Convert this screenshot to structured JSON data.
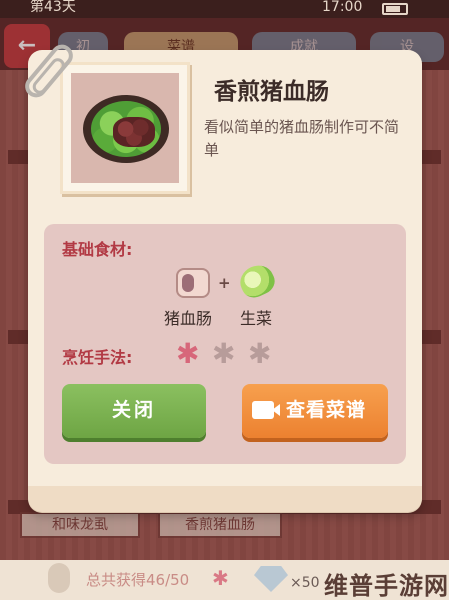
{
  "status_bar": {
    "day": "第43天",
    "time": "17:00"
  },
  "background": {
    "tabs": [
      {
        "label": "初"
      },
      {
        "label": "菜谱",
        "active": true
      },
      {
        "label": "成就"
      },
      {
        "label": "设"
      }
    ],
    "shelf_labels": [
      "和味龙虱",
      "香煎猪血肠"
    ],
    "total_label": "总共获得46/50",
    "gem_count": "×50",
    "watermark": "维普手游网"
  },
  "dialog": {
    "dish_name": "香煎猪血肠",
    "description": "看似简单的猪血肠制作可不简单",
    "ingredients_label": "基础食材:",
    "ingredients": [
      {
        "name": "猪血肠",
        "icon": "blood-sausage-icon"
      },
      {
        "name": "生菜",
        "icon": "lettuce-icon"
      }
    ],
    "plus": "+",
    "cooking_label": "烹饪手法:",
    "difficulty": {
      "filled": 1,
      "total": 3
    },
    "buttons": {
      "close": "关闭",
      "view_recipe": "查看菜谱"
    }
  },
  "colors": {
    "accent_red": "#b23a44",
    "close_green": "#6ea544",
    "recipe_orange": "#ec8130",
    "flower_active": "#d7677a"
  }
}
